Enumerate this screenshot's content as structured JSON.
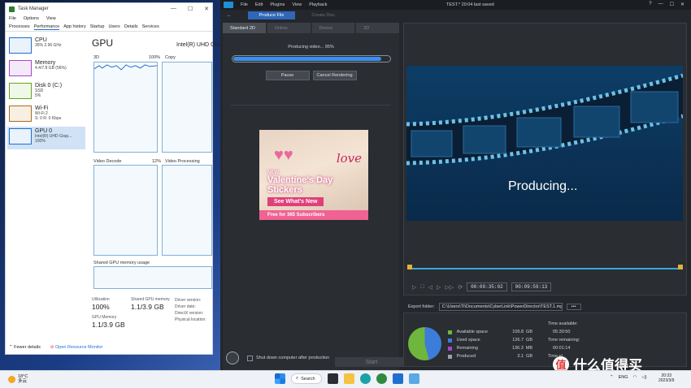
{
  "task_manager": {
    "window_title": "Task Manager",
    "window_buttons": [
      "—",
      "☐",
      "✕"
    ],
    "menu": [
      "File",
      "Options",
      "View"
    ],
    "tabs": [
      "Processes",
      "Performance",
      "App history",
      "Startup",
      "Users",
      "Details",
      "Services"
    ],
    "active_tab": "Performance",
    "resources": [
      {
        "name": "CPU",
        "lines": [
          "35% 2.96 GHz"
        ],
        "color": "#1f6fd1"
      },
      {
        "name": "Memory",
        "lines": [
          "4.4/7.8 GB (56%)"
        ],
        "color": "#a347c8"
      },
      {
        "name": "Disk 0 (C:)",
        "lines": [
          "SSD",
          "5%"
        ],
        "color": "#5ea71e"
      },
      {
        "name": "Wi-Fi",
        "lines": [
          "Wi-Fi 2",
          "S: 0 R: 0 Kbps"
        ],
        "color": "#a86b1e"
      },
      {
        "name": "GPU 0",
        "lines": [
          "Intel(R) UHD Grap...",
          "100%"
        ],
        "color": "#1f6fd1"
      }
    ],
    "gpu": {
      "title": "GPU",
      "model": "Intel(R) UHD Gra",
      "graphs": [
        {
          "label": "3D",
          "pct": "100%"
        },
        {
          "label": "Copy",
          "pct": ""
        },
        {
          "label": "Video Decode",
          "pct": "12%"
        },
        {
          "label": "Video Processing",
          "pct": ""
        }
      ],
      "shared_memory_label": "Shared GPU memory usage",
      "stats": {
        "utilization_label": "Utilization",
        "utilization": "100%",
        "shared_label": "Shared GPU memory",
        "shared": "1.1/3.9 GB",
        "gpu_memory_label": "GPU Memory",
        "gpu_memory": "1.1/3.9 GB",
        "driver_version_label": "Driver version:",
        "driver_date_label": "Driver date:",
        "directx_label": "DirectX version:",
        "physical_location_label": "Physical location:"
      }
    },
    "footer": {
      "fewer_details": "Fewer details",
      "open_resource_monitor": "Open Resource Monitor"
    }
  },
  "powerdirector": {
    "menu": [
      "File",
      "Edit",
      "Plugins",
      "View",
      "Playback"
    ],
    "title": "TEST.* 20:04 last saved",
    "right_icons": [
      "?",
      "—",
      "☐",
      "✕"
    ],
    "mode_buttons": {
      "produce": "Produce File",
      "create_disc": "Create Disc"
    },
    "format_tabs": [
      "Standard 2D",
      "Online",
      "Device",
      "3D"
    ],
    "producing_status": "Producing video... 95%",
    "progress": 0.95,
    "buttons": {
      "pause": "Pause",
      "cancel": "Cancel Rendering"
    },
    "ad": {
      "new": "NEW",
      "headline": "Valentine's Day Stickers",
      "cta": "See What's New",
      "footer": "Free for 365 Subscribers",
      "love": "love"
    },
    "shutdown_label": "Shut down computer after production",
    "start_label": "Start",
    "preview_text": "Producing...",
    "timecodes": [
      "00:09:35:02",
      "00:09:59:13"
    ],
    "export_folder_label": "Export folder:",
    "export_folder": "C:\\Users\\TI\\Documents\\CyberLink\\PowerDirector\\TEST.1.mp4",
    "browse": "•••",
    "disk": {
      "rows": [
        {
          "label": "Available space",
          "value": "109.8",
          "unit": "GB",
          "color": "#6fb63c"
        },
        {
          "label": "Used space",
          "value": "126.7",
          "unit": "GB",
          "color": "#3b7dd8"
        },
        {
          "label": "Remaining",
          "value": "136.3",
          "unit": "MB",
          "color": "#a347c8"
        },
        {
          "label": "Produced",
          "value": "3.1",
          "unit": "GB",
          "color": "#9aa0a6"
        }
      ],
      "time_available_label": "Time available:",
      "time_available": "05:30:50",
      "time_remaining_label": "Time remaining:",
      "time_remaining": "00:01:14",
      "time_elapsed_label": "Time el"
    }
  },
  "taskbar": {
    "temperature": "18°C",
    "weather_text": "多云",
    "search_label": "Search",
    "lang": "ENG",
    "time": "20:33",
    "date": "2023/3/9"
  },
  "watermark": {
    "badge": "值",
    "text": "什么值得买"
  }
}
